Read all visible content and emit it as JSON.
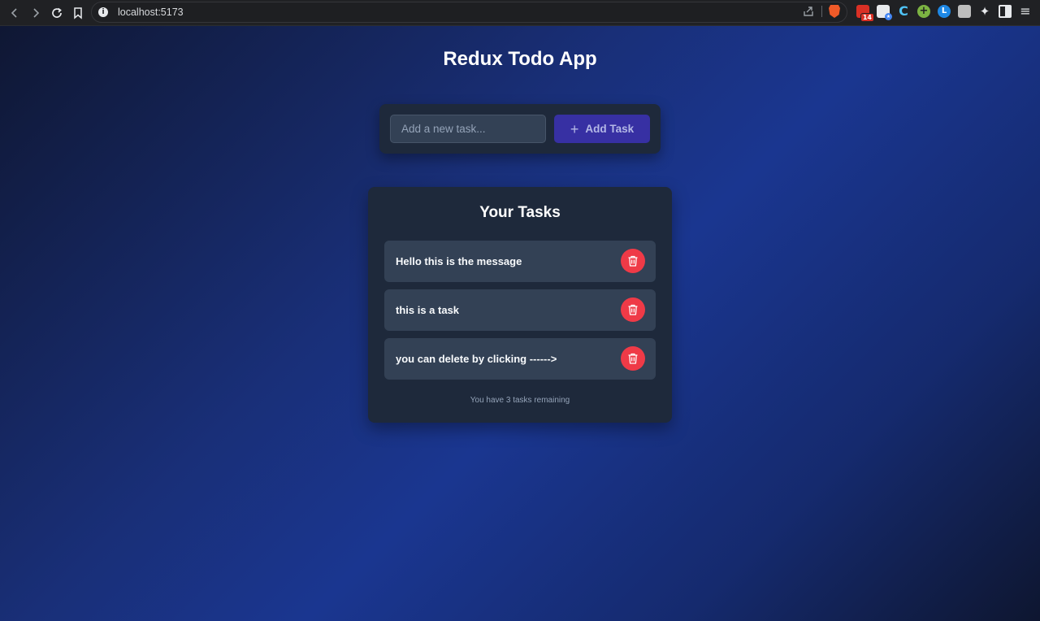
{
  "browser": {
    "url": "localhost:5173",
    "extension_badge": "14",
    "nav": {
      "back_icon": "chevron-left-icon",
      "forward_icon": "chevron-right-icon",
      "reload_icon": "reload-icon",
      "bookmark_icon": "bookmark-icon"
    }
  },
  "app": {
    "title": "Redux Todo App"
  },
  "add_form": {
    "placeholder": "Add a new task...",
    "button_label": "Add Task",
    "button_icon": "plus-icon"
  },
  "tasks_panel": {
    "title": "Your Tasks",
    "tasks": [
      {
        "text": "Hello this is the message"
      },
      {
        "text": "this is a task"
      },
      {
        "text": "you can delete by clicking ------>"
      }
    ],
    "remaining_text": "You have 3 tasks remaining"
  },
  "colors": {
    "accent": "#3730a3",
    "delete": "#ef3a47",
    "card": "#1e293b",
    "task_row": "#334155"
  }
}
